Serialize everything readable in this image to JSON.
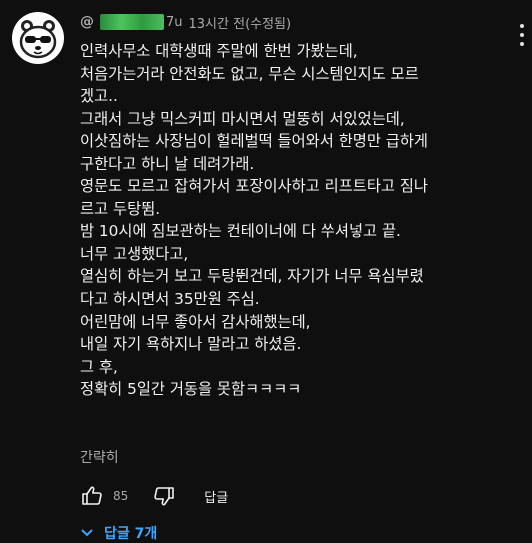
{
  "comment": {
    "handle_prefix": "@",
    "handle_suffix": "7u",
    "timestamp": "13시간 전(수정됨)",
    "lines": [
      "인력사무소 대학생때 주말에 한번 가봤는데,",
      "처음가는거라 안전화도 없고, 무슨 시스템인지도 모르",
      "겠고..",
      "그래서 그냥 믹스커피 마시면서 멀뚱히 서있었는데,",
      "이삿짐하는 사장님이 헐레벌떡 들어와서 한명만 급하게",
      "구한다고 하니 날 데려가래.",
      "영문도 모르고 잡혀가서 포장이사하고 리프트타고 짐나",
      "르고 두탕뜀.",
      "밤 10시에 짐보관하는 컨테이너에 다 쑤셔넣고 끝.",
      "너무 고생했다고,",
      "열심히 하는거 보고 두탕뛴건데, 자기가 너무 욕심부렸",
      "다고 하시면서 35만원 주심.",
      "어린맘에 너무 좋아서 감사해했는데,",
      "내일 자기 욕하지나 말라고 하셨음.",
      "그 후,",
      "정확히 5일간 거동을 못함ㅋㅋㅋㅋ"
    ],
    "read_more": "간략히",
    "like_count": "85",
    "reply_label": "답글",
    "replies_toggle": "답글 7개"
  },
  "icons": {
    "avatar": "bear-avatar",
    "like": "thumbs-up-icon",
    "dislike": "thumbs-down-icon",
    "menu": "more-vert-icon",
    "expand": "chevron-down-icon"
  },
  "colors": {
    "background": "#0f0f0f",
    "text": "#f1f1f1",
    "secondary": "#aaaaaa",
    "link": "#3ea6ff"
  }
}
